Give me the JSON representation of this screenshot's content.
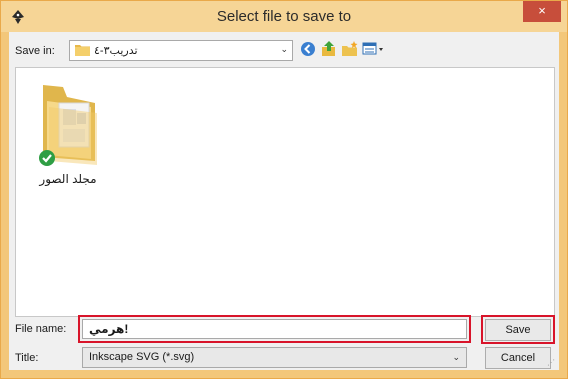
{
  "window": {
    "title": "Select file to save to",
    "close_symbol": "×",
    "app_icon": "inkscape-icon"
  },
  "toolbar": {
    "save_in_label": "Save in:",
    "save_in_value": "تدريب٣-٤",
    "icons": [
      "back-icon",
      "up-folder-icon",
      "new-folder-icon",
      "view-menu-icon"
    ]
  },
  "file_list": {
    "items": [
      {
        "label": "مجلد الصور",
        "icon": "pictures-folder-icon",
        "status": "synced-check"
      }
    ]
  },
  "file_name": {
    "label": "File name:",
    "value": "هرمي!"
  },
  "file_type": {
    "label": "Title:",
    "value": "Inkscape SVG (*.svg)"
  },
  "buttons": {
    "save_label": "Save",
    "cancel_label": "Cancel"
  },
  "colors": {
    "highlight": "#d8142a",
    "frame": "#f3c77a",
    "close": "#c74e3b"
  }
}
